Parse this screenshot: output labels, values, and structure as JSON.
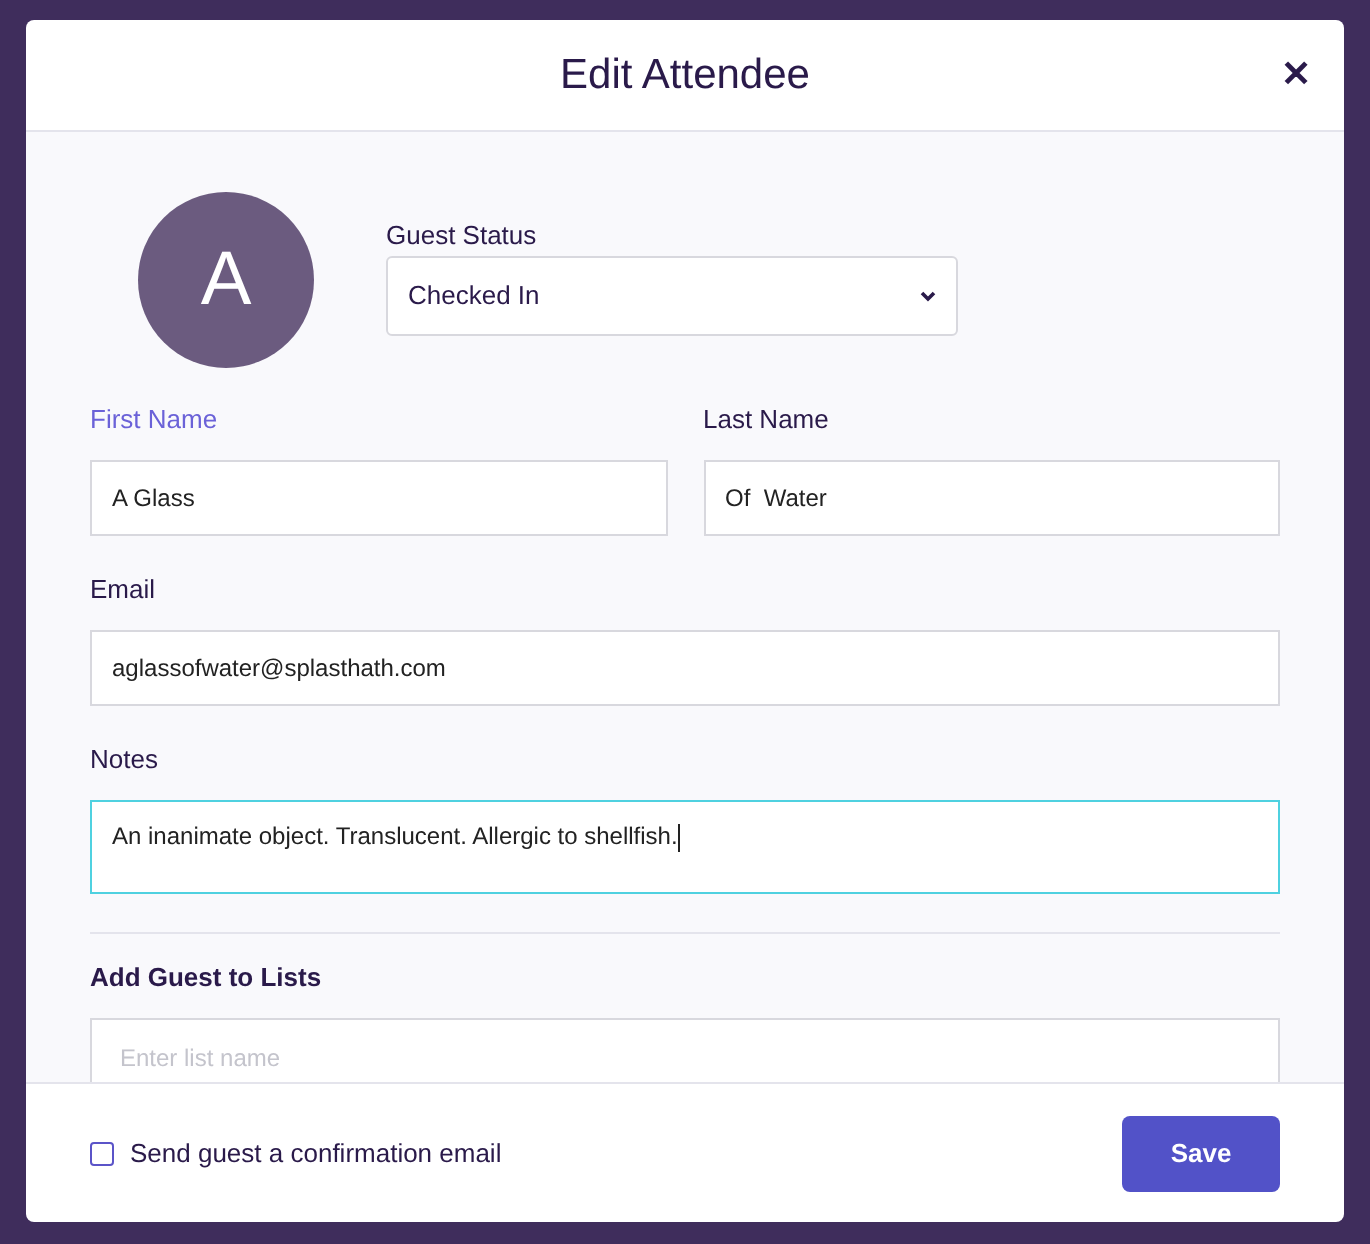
{
  "dialog": {
    "title": "Edit Attendee",
    "close": "✕"
  },
  "avatar": {
    "initial": "A"
  },
  "guest_status": {
    "label": "Guest Status",
    "value": "Checked In"
  },
  "name_fields": [
    {
      "label": "First Name",
      "value": "A Glass",
      "highlighted": true
    },
    {
      "label": "Last Name",
      "value": "Of  Water",
      "highlighted": false
    }
  ],
  "email": {
    "label": "Email",
    "value": "aglassofwater@splasthath.com"
  },
  "notes": {
    "label": "Notes",
    "value": "An inanimate object. Translucent. Allergic to shellfish.",
    "focused": true
  },
  "lists": {
    "heading": "Add Guest to Lists",
    "placeholder": "Enter list name"
  },
  "footer": {
    "checkbox": {
      "label": "Send guest a confirmation email",
      "checked": false
    },
    "save": "Save"
  }
}
